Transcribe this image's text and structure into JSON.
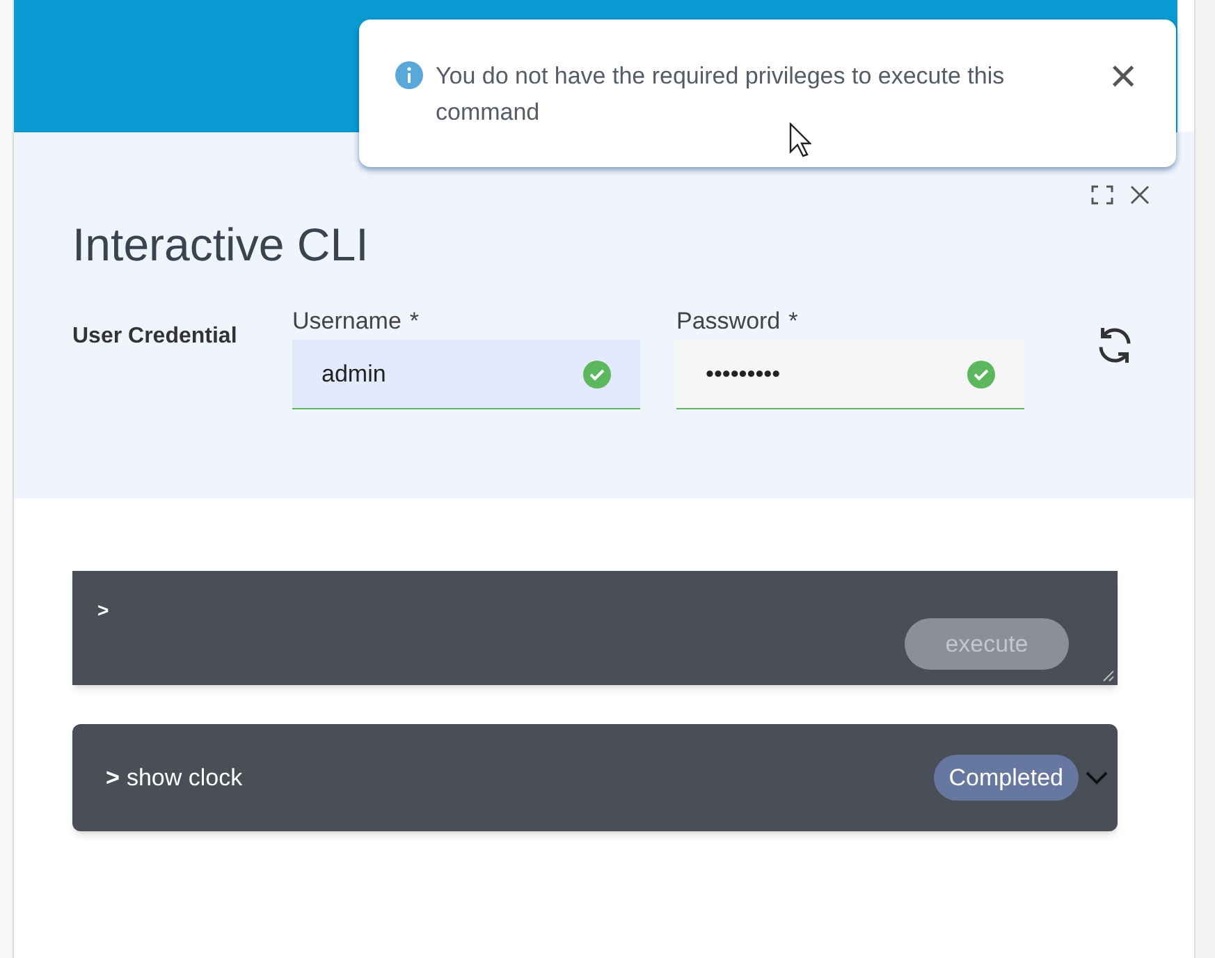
{
  "toast": {
    "message": "You do not have the required privileges to execute this command",
    "close": "×"
  },
  "dialog": {
    "title": "Interactive CLI",
    "section_label": "User Credential",
    "fields": [
      {
        "label": "Username",
        "required_mark": "*",
        "value": "admin",
        "valid": true,
        "focused": true
      },
      {
        "label": "Password",
        "required_mark": "*",
        "value": "•••••••••",
        "valid": true,
        "focused": false
      }
    ],
    "command_input": {
      "prompt": ">",
      "button": "execute",
      "disabled": true
    },
    "results": [
      {
        "prompt": ">",
        "command": "show clock",
        "status": "Completed",
        "expanded": false
      }
    ]
  }
}
